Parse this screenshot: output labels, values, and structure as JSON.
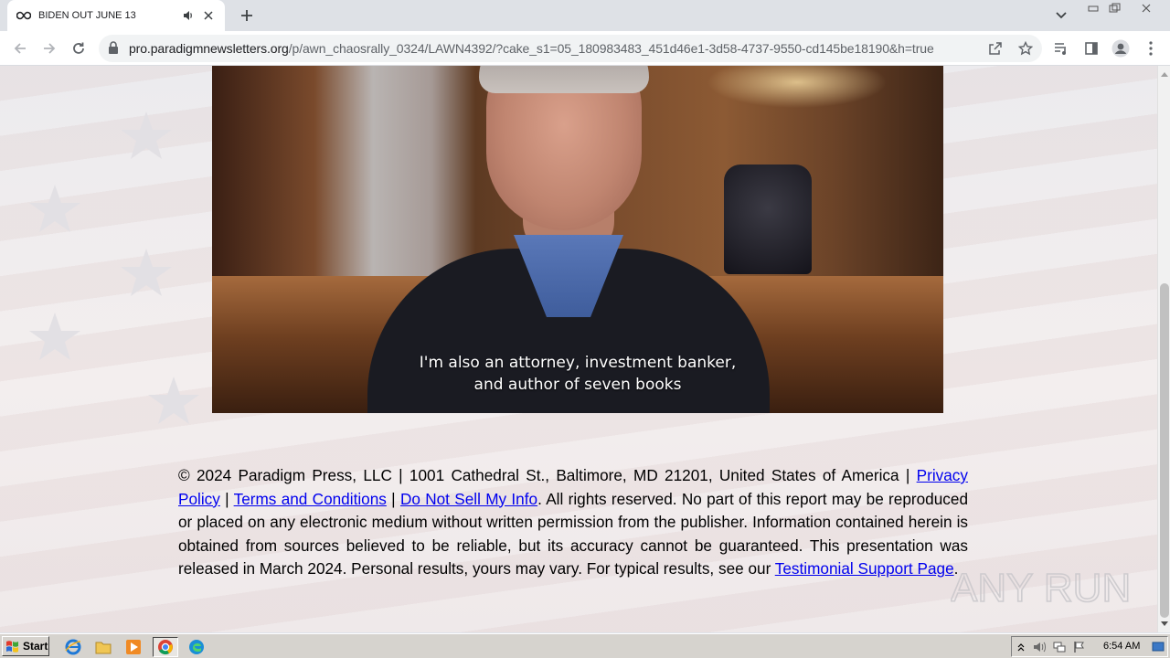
{
  "browser": {
    "tab": {
      "title": "BIDEN OUT JUNE 13"
    },
    "address_bar": {
      "host": "pro.paradigmnewsletters.org",
      "path": "/p/awn_chaosrally_0324/LAWN4392/?cake_s1=05_180983483_451d46e1-3d58-4737-9550-cd145be18190&h=true"
    }
  },
  "video": {
    "subtitle_line1": "I'm also an attorney, investment banker,",
    "subtitle_line2": "and author of seven books"
  },
  "footer": {
    "copyright": "© 2024 Paradigm Press, LLC | 1001 Cathedral St., Baltimore, MD 21201, United States of America | ",
    "privacy_link": "Privacy Policy",
    "sep1": " | ",
    "terms_link": "Terms and Conditions",
    "sep2": " | ",
    "dnsmi_link": "Do Not Sell My Info",
    "body": ". All rights reserved. No part of this report may be reproduced or placed on any electronic medium without written permission from the publisher. Information contained herein is obtained from sources believed to be reliable, but its accuracy cannot be guaranteed. This presentation was released in March 2024. Personal results, yours may vary. For typical results, see our ",
    "testimonial_link": "Testimonial Support Page",
    "end": "."
  },
  "watermark": {
    "text": "ANY RUN"
  },
  "taskbar": {
    "start_label": "Start",
    "clock": "6:54 AM"
  }
}
